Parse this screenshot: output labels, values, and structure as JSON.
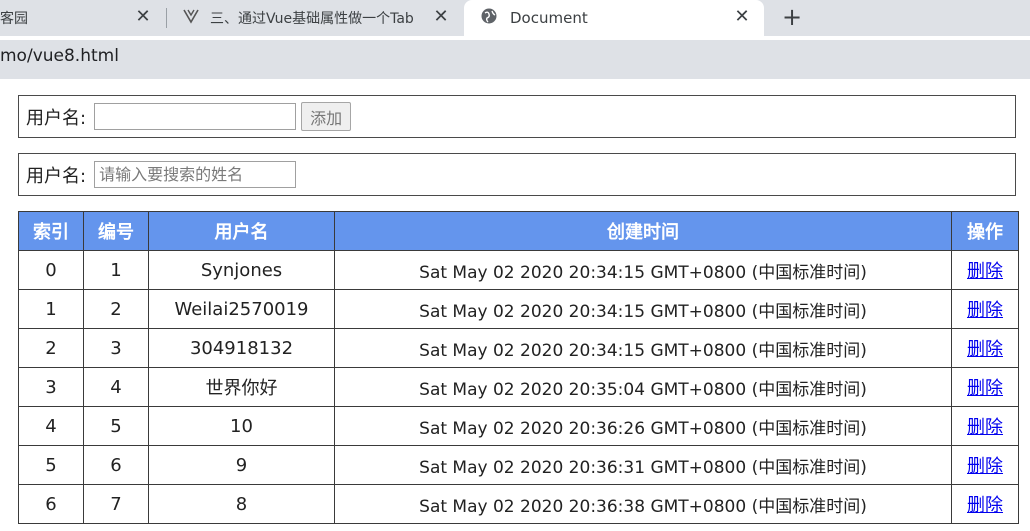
{
  "browser": {
    "tabs": [
      {
        "title": "客园",
        "icon": "close-x"
      },
      {
        "title": "三、通过Vue基础属性做一个Tab",
        "icon": "vue-logo"
      },
      {
        "title": "Document",
        "icon": "globe"
      }
    ],
    "new_tab_label": "+",
    "url": "mo/vue8.html"
  },
  "add_form": {
    "label": "用户名:",
    "input_value": "",
    "button_label": "添加"
  },
  "search_form": {
    "label": "用户名:",
    "placeholder": "请输入要搜索的姓名"
  },
  "table": {
    "header_color": "#6495ed",
    "headers": [
      "索引",
      "编号",
      "用户名",
      "创建时间",
      "操作"
    ],
    "rows": [
      {
        "index": "0",
        "id": "1",
        "name": "Synjones",
        "created": "Sat May 02 2020 20:34:15 GMT+0800 (中国标准时间)",
        "action": "删除"
      },
      {
        "index": "1",
        "id": "2",
        "name": "Weilai2570019",
        "created": "Sat May 02 2020 20:34:15 GMT+0800 (中国标准时间)",
        "action": "删除"
      },
      {
        "index": "2",
        "id": "3",
        "name": "304918132",
        "created": "Sat May 02 2020 20:34:15 GMT+0800 (中国标准时间)",
        "action": "删除"
      },
      {
        "index": "3",
        "id": "4",
        "name": "世界你好",
        "created": "Sat May 02 2020 20:35:04 GMT+0800 (中国标准时间)",
        "action": "删除"
      },
      {
        "index": "4",
        "id": "5",
        "name": "10",
        "created": "Sat May 02 2020 20:36:26 GMT+0800 (中国标准时间)",
        "action": "删除"
      },
      {
        "index": "5",
        "id": "6",
        "name": "9",
        "created": "Sat May 02 2020 20:36:31 GMT+0800 (中国标准时间)",
        "action": "删除"
      },
      {
        "index": "6",
        "id": "7",
        "name": "8",
        "created": "Sat May 02 2020 20:36:38 GMT+0800 (中国标准时间)",
        "action": "删除"
      }
    ]
  }
}
